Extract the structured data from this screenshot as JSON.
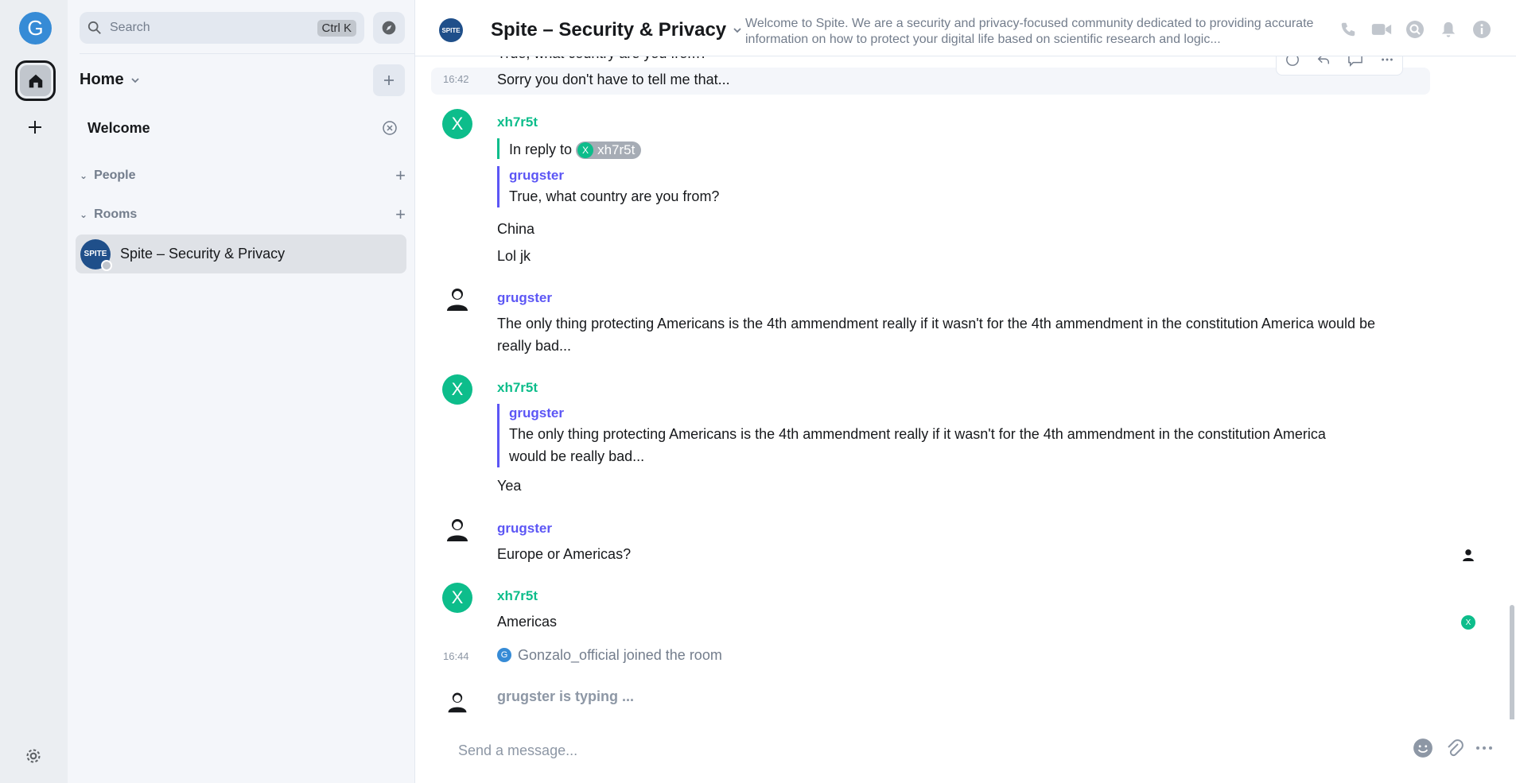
{
  "colors": {
    "accent": "#0dbd8b",
    "secondary_user": "#5c56f5",
    "user_avatar": "#368bd6"
  },
  "spacebar": {
    "user_initial": "G",
    "icons": [
      "home-icon",
      "plus-icon",
      "gear-icon"
    ]
  },
  "roomlist": {
    "search_placeholder": "Search",
    "search_shortcut": "Ctrl K",
    "home_title": "Home",
    "welcome_label": "Welcome",
    "sections": [
      {
        "label": "People"
      },
      {
        "label": "Rooms"
      }
    ],
    "rooms": [
      {
        "name": "Spite – Security & Privacy",
        "avatar_text": "SPITE"
      }
    ]
  },
  "header": {
    "title": "Spite – Security & Privacy",
    "avatar_text": "SPITE",
    "topic": "Welcome to Spite. We are a security and privacy-focused community dedicated to providing accurate information on how to protect your digital life based on scientific research and logic..."
  },
  "timeline": {
    "partial_top": "True, what country are you from?",
    "hovered": {
      "time": "16:42",
      "text": "Sorry you don't have to tell me that..."
    },
    "events": [
      {
        "sender": "xh7r5t",
        "avatar": "X",
        "reply_prefix": "In reply to",
        "reply_pill": "xh7r5t",
        "quote_sender": "grugster",
        "quote_text": "True, what country are you from?",
        "lines": [
          "China",
          "Lol jk"
        ]
      },
      {
        "sender": "grugster",
        "text": "The only thing protecting Americans is the 4th ammendment really if it wasn't for the 4th ammendment in the constitution America would be really bad..."
      },
      {
        "sender": "xh7r5t",
        "avatar": "X",
        "quote_sender": "grugster",
        "quote_text": "The only thing protecting Americans is the 4th ammendment really if it wasn't for the 4th ammendment in the constitution America would be really bad...",
        "text": "Yea"
      },
      {
        "sender": "grugster",
        "text": "Europe or Americas?"
      },
      {
        "sender": "xh7r5t",
        "avatar": "X",
        "text": "Americas"
      }
    ],
    "join": {
      "time": "16:44",
      "avatar": "G",
      "text": "Gonzalo_official joined the room"
    },
    "typing": "grugster is typing ..."
  },
  "composer": {
    "placeholder": "Send a message..."
  }
}
